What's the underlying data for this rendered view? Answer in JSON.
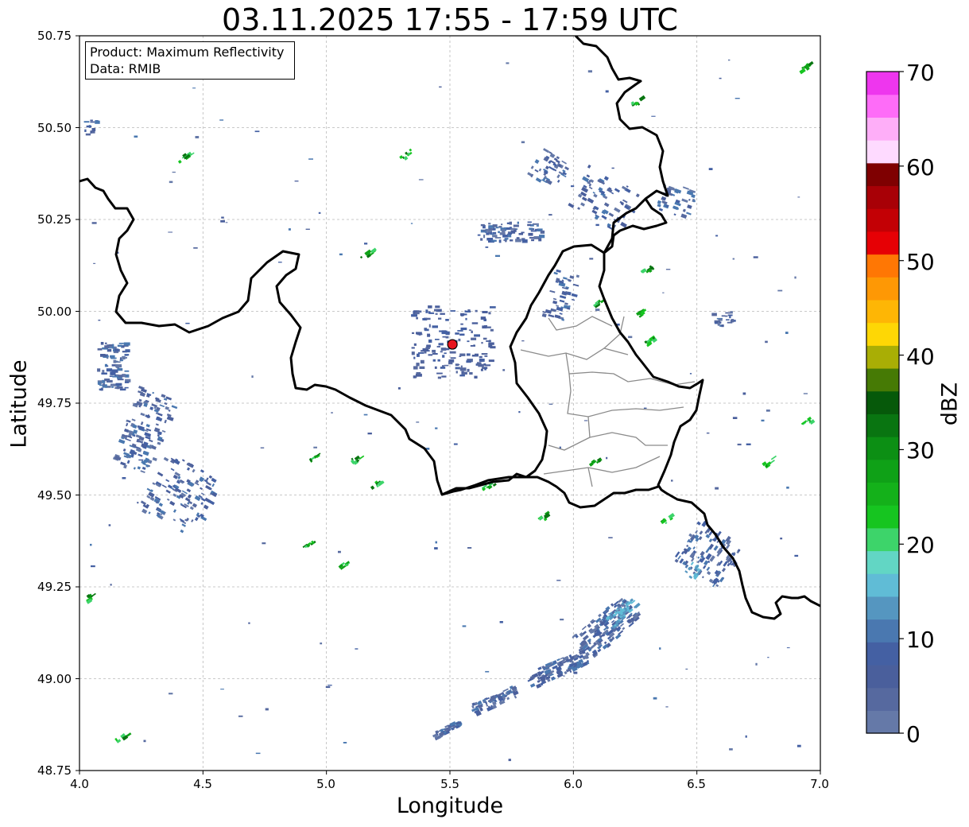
{
  "title": "03.11.2025 17:55 - 17:59 UTC",
  "info_box": {
    "product": "Product: Maximum Reflectivity",
    "data_source": "Data: RMIB"
  },
  "axes": {
    "xlabel": "Longitude",
    "ylabel": "Latitude",
    "xticks": [
      "4.0",
      "4.5",
      "5.0",
      "5.5",
      "6.0",
      "6.5",
      "7.0"
    ],
    "yticks": [
      "50.75",
      "50.50",
      "50.25",
      "50.00",
      "49.75",
      "49.50",
      "49.25",
      "49.00",
      "48.75"
    ],
    "xlim": [
      4.0,
      7.0
    ],
    "ylim": [
      48.75,
      50.75
    ],
    "grid": true
  },
  "colorbar": {
    "label": "dBZ",
    "ticks": [
      "0",
      "10",
      "20",
      "30",
      "40",
      "50",
      "60",
      "70"
    ],
    "range": [
      0,
      70
    ],
    "colors": [
      "#6579a8",
      "#56699f",
      "#4a5f9c",
      "#4460a3",
      "#4a78b0",
      "#5596c0",
      "#60bcd6",
      "#62d6c4",
      "#3dd46a",
      "#16c520",
      "#14b11a",
      "#0fa117",
      "#0c8f14",
      "#097511",
      "#06590a",
      "#467a05",
      "#a9ae05",
      "#fed705",
      "#feb605",
      "#fe9805",
      "#ff7704",
      "#e60005",
      "#c30005",
      "#a80006",
      "#7f0001",
      "#fedaff",
      "#feaef8",
      "#fe6cf8",
      "#ee36ee"
    ]
  },
  "radar_site": {
    "lon": 5.51,
    "lat": 49.91,
    "color": "#e8141e"
  }
}
